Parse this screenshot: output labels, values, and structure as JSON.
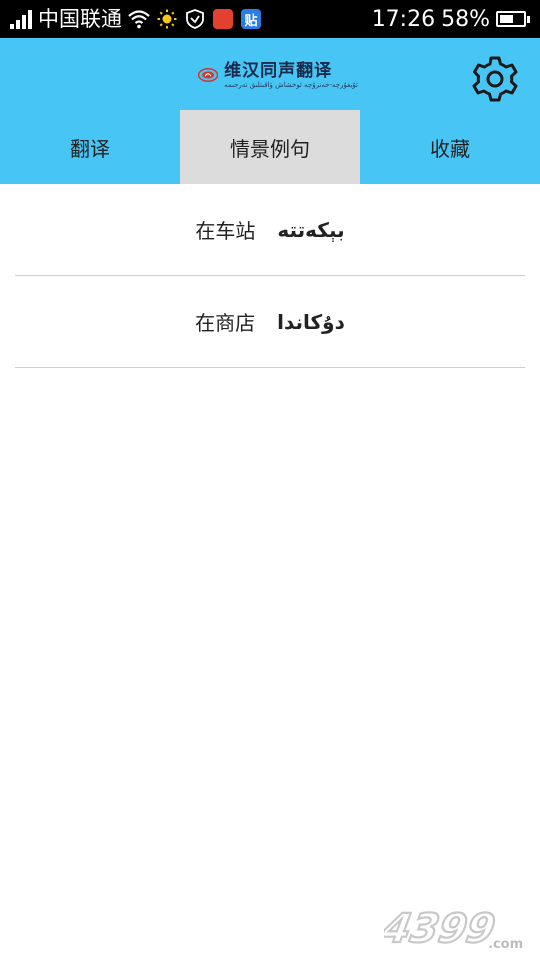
{
  "status_bar": {
    "carrier": "中国联通",
    "time": "17:26",
    "battery_percent": "58%",
    "battery_level": 0.58,
    "icons": [
      "signal-icon",
      "wifi-icon",
      "brightness-icon",
      "vpn-shield-icon",
      "app-notification-icon",
      "tieba-icon",
      "battery-icon"
    ],
    "tieba_glyph": "贴"
  },
  "header": {
    "logo_title": "维汉同声翻译",
    "logo_subtitle": "ئۇيغۇرچە-خەنزۇچە ئوخشاش ۋاقىتلىق تەرجىمە",
    "background_color": "#47c6f5",
    "settings_icon": "gear-icon"
  },
  "tabs": [
    {
      "label": "翻译",
      "active": false
    },
    {
      "label": "情景例句",
      "active": true
    },
    {
      "label": "收藏",
      "active": false
    }
  ],
  "scenarios": [
    {
      "zh": "在车站",
      "ug": "بېكەتتە"
    },
    {
      "zh": "在商店",
      "ug": "دۇكاندا"
    }
  ],
  "watermark": {
    "text": "4399",
    "suffix": ".com"
  }
}
